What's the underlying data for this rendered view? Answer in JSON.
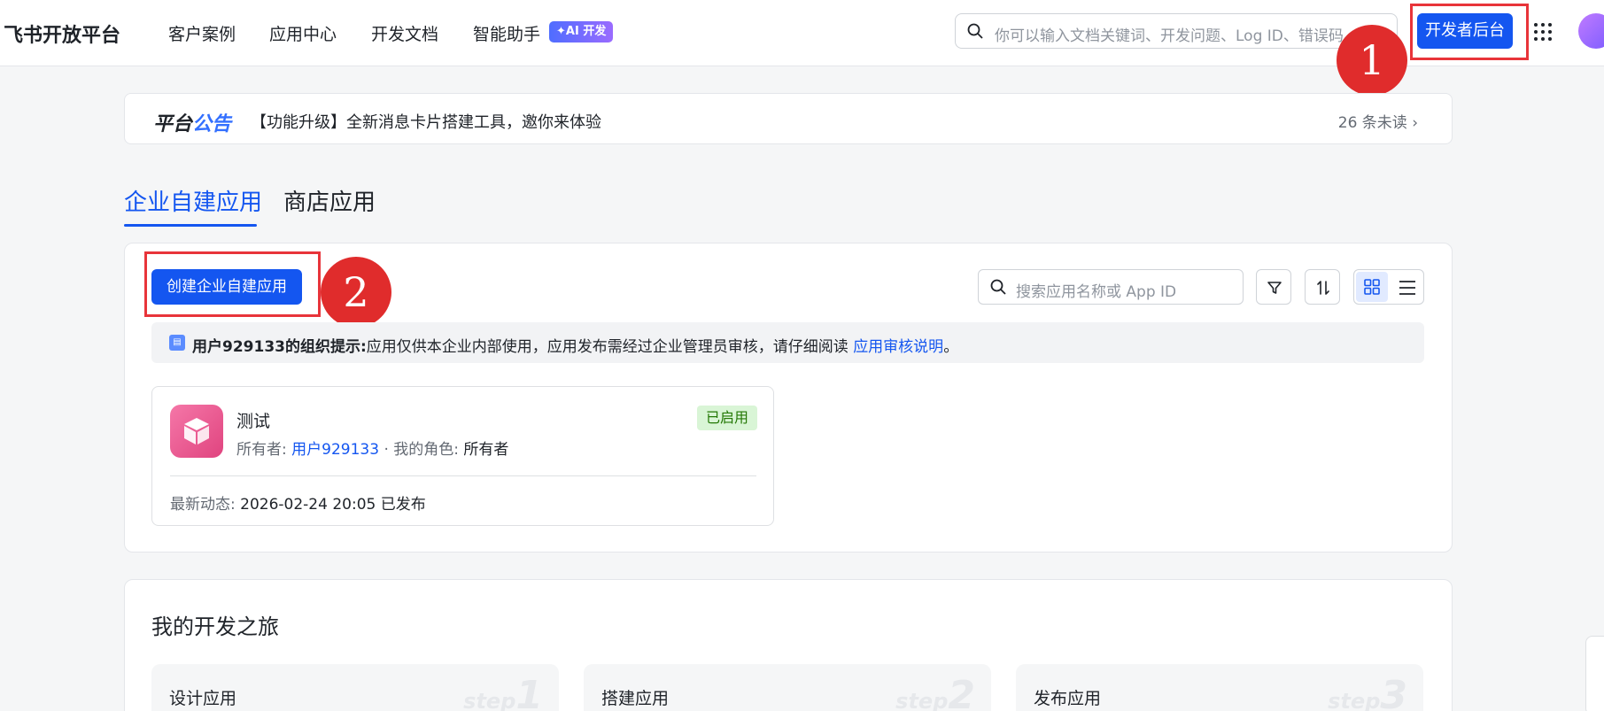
{
  "header": {
    "logo": "飞书开放平台",
    "nav": [
      "客户案例",
      "应用中心",
      "开发文档",
      "智能助手"
    ],
    "ai_badge": "✦AI 开发",
    "search_placeholder": "你可以输入文档关键词、开发问题、Log ID、错误码",
    "dev_console": "开发者后台"
  },
  "annotations": {
    "marker1": "1",
    "marker2": "2"
  },
  "announcement": {
    "label_part1": "平台",
    "label_part2": "公告",
    "message": "【功能升级】全新消息卡片搭建工具，邀你来体验",
    "unread": "26 条未读 ›"
  },
  "tabs": [
    "企业自建应用",
    "商店应用"
  ],
  "toolbar": {
    "create_button": "创建企业自建应用",
    "search_placeholder": "搜索应用名称或 App ID"
  },
  "tip": {
    "bold": "用户929133的组织提示:",
    "text": "应用仅供本企业内部使用，应用发布需经过企业管理员审核，请仔细阅读 ",
    "link": "应用审核说明",
    "end": "。"
  },
  "app": {
    "name": "测试",
    "owner_label": "所有者: ",
    "owner": "用户929133",
    "role_label": " · 我的角色: ",
    "role": "所有者",
    "status": "已启用",
    "latest_label": "最新动态: ",
    "latest_value": "2026-02-24 20:05 已发布"
  },
  "journey": {
    "title": "我的开发之旅",
    "steps": [
      {
        "title": "设计应用",
        "mark_text": "step",
        "mark_num": "1"
      },
      {
        "title": "搭建应用",
        "mark_text": "step",
        "mark_num": "2"
      },
      {
        "title": "发布应用",
        "mark_text": "step",
        "mark_num": "3"
      }
    ]
  },
  "colors": {
    "primary": "#1456f0",
    "annotation_red": "#e8343a",
    "enabled_green": "#237804"
  }
}
